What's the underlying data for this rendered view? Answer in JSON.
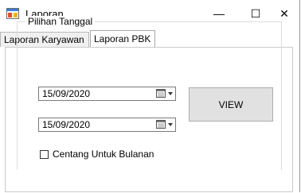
{
  "window": {
    "title": "Laporan",
    "icon": "form-app-icon",
    "controls": {
      "minimize": "—",
      "maximize": "☐",
      "close": "✕"
    }
  },
  "tabs": [
    {
      "label": "Laporan Karyawan",
      "selected": false
    },
    {
      "label": "Laporan PBK",
      "selected": true
    }
  ],
  "group": {
    "title": "Pilihan Tanggal",
    "date_from": "15/09/2020",
    "date_to": "15/09/2020",
    "view_button": "VIEW",
    "monthly_checkbox": {
      "label": "Centang Untuk Bulanan",
      "checked": false
    }
  },
  "colors": {
    "button_face": "#e1e1e1",
    "tab_inactive": "#f0f0f0",
    "border": "#adadad"
  }
}
